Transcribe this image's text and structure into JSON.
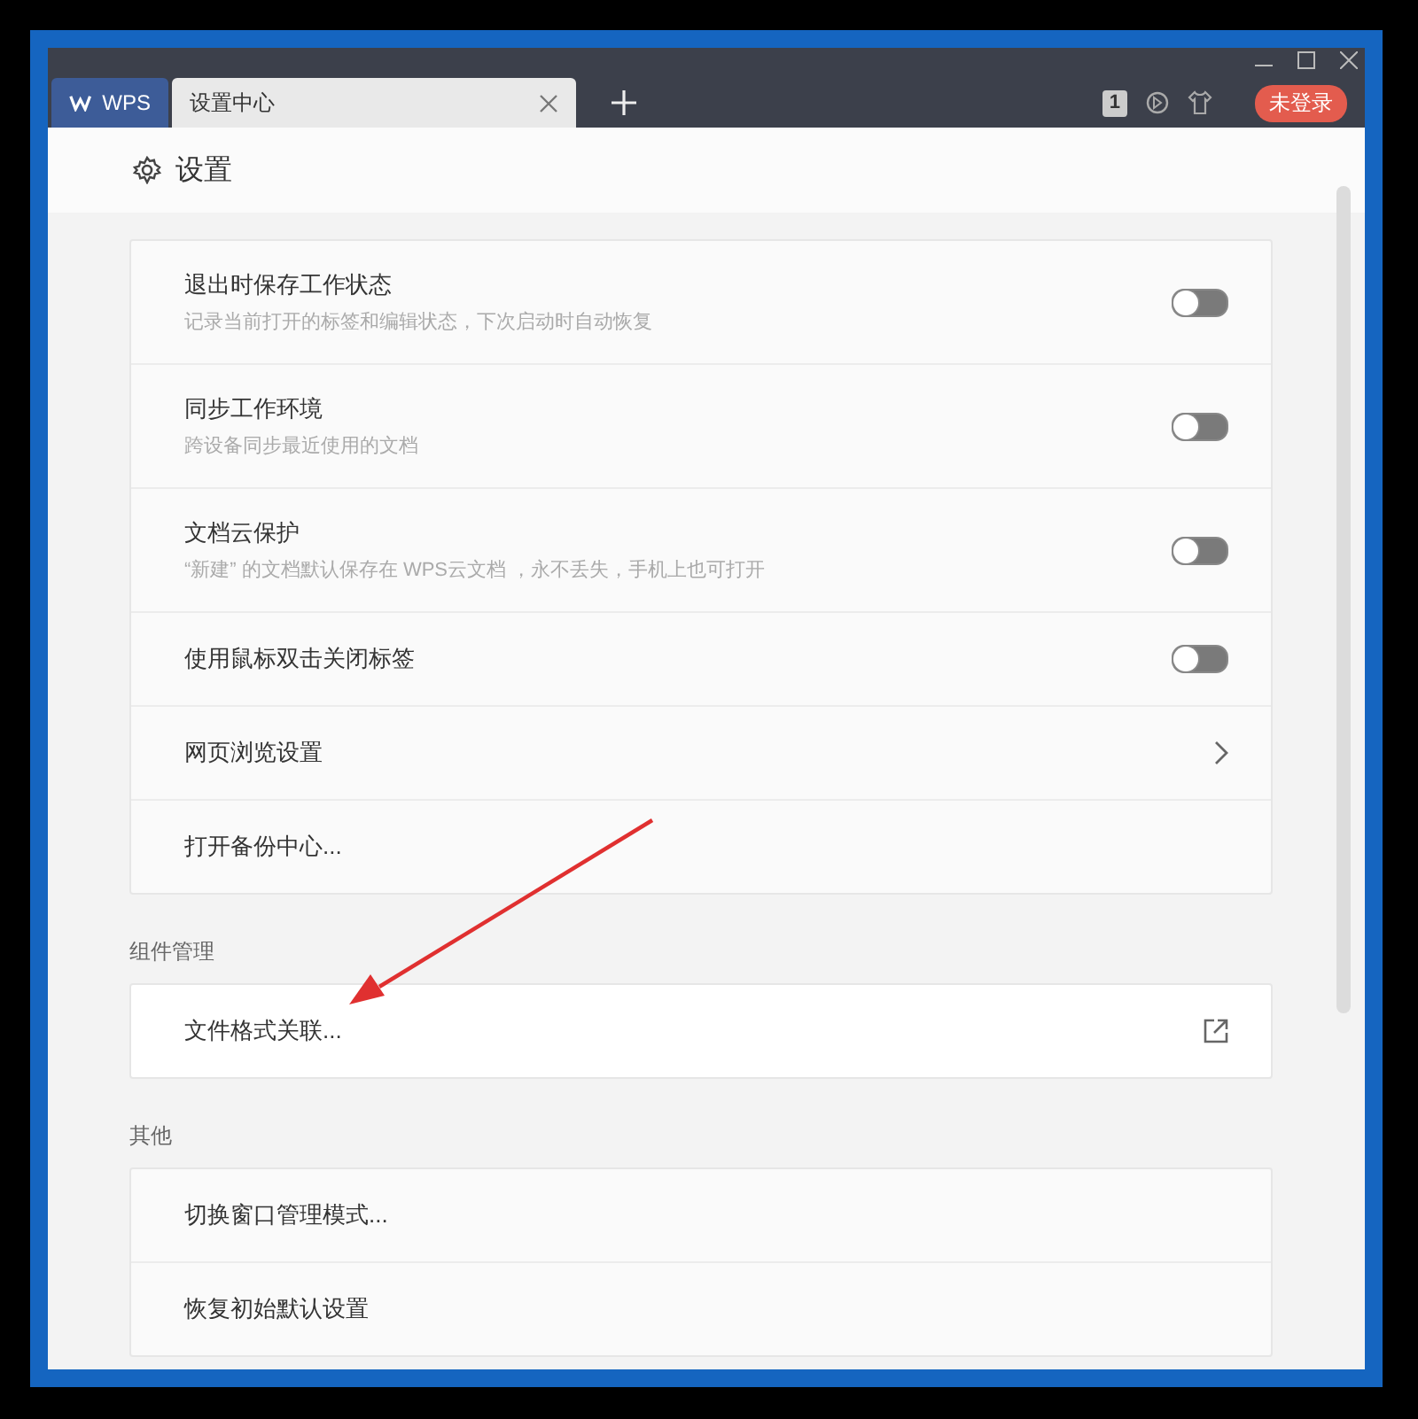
{
  "window": {
    "tabs": [
      {
        "label": "WPS",
        "kind": "app",
        "selected": false
      },
      {
        "label": "设置中心",
        "kind": "doc",
        "selected": true
      }
    ],
    "window_count": "1",
    "login_button": "未登录"
  },
  "page": {
    "title": "设置"
  },
  "sections": [
    {
      "items": [
        {
          "kind": "toggle",
          "label": "退出时保存工作状态",
          "description": "记录当前打开的标签和编辑状态，下次启动时自动恢复",
          "on": false
        },
        {
          "kind": "toggle",
          "label": "同步工作环境",
          "description": "跨设备同步最近使用的文档",
          "on": false
        },
        {
          "kind": "toggle",
          "label": "文档云保护",
          "description": "“新建” 的文档默认保存在 WPS云文档 ，永不丢失，手机上也可打开",
          "on": false
        },
        {
          "kind": "toggle",
          "label": "使用鼠标双击关闭标签",
          "on": false
        },
        {
          "kind": "chevron",
          "label": "网页浏览设置"
        },
        {
          "kind": "plain",
          "label": "打开备份中心..."
        }
      ]
    },
    {
      "title": "组件管理",
      "items": [
        {
          "kind": "external",
          "label": "文件格式关联..."
        }
      ]
    },
    {
      "title": "其他",
      "items": [
        {
          "kind": "plain",
          "label": "切换窗口管理模式..."
        },
        {
          "kind": "plain",
          "label": "恢复初始默认设置"
        }
      ]
    }
  ]
}
